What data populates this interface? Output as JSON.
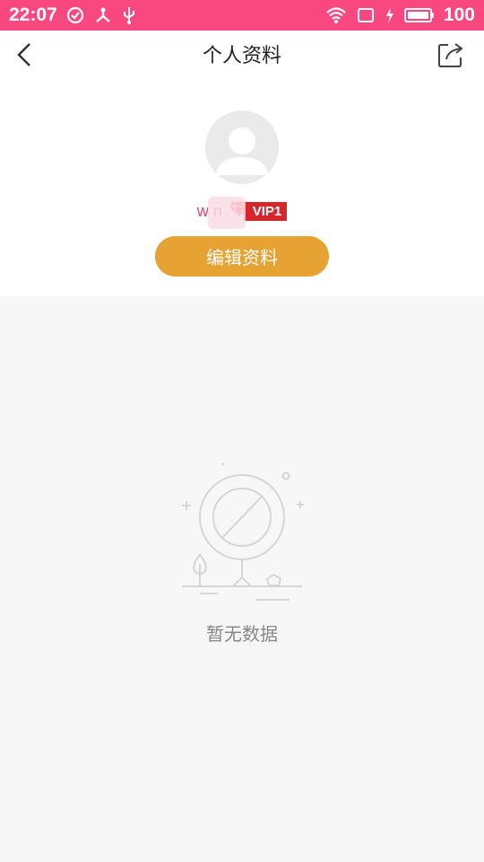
{
  "status_bar": {
    "time": "22:07",
    "battery_level": "100",
    "background_color": "#f9477f",
    "icons": [
      "check-circle-icon",
      "network-share-icon",
      "usb-icon",
      "wifi-icon",
      "screen-icon",
      "charging-icon",
      "battery-icon"
    ]
  },
  "header": {
    "title": "个人资料",
    "back_icon": "chevron-left-icon",
    "share_icon": "share-icon"
  },
  "profile": {
    "username": "w n",
    "vip_badge": "VIP1",
    "edit_button": "编辑资料",
    "accent_color": "#e6a233"
  },
  "empty_state": {
    "message": "暂无数据"
  }
}
